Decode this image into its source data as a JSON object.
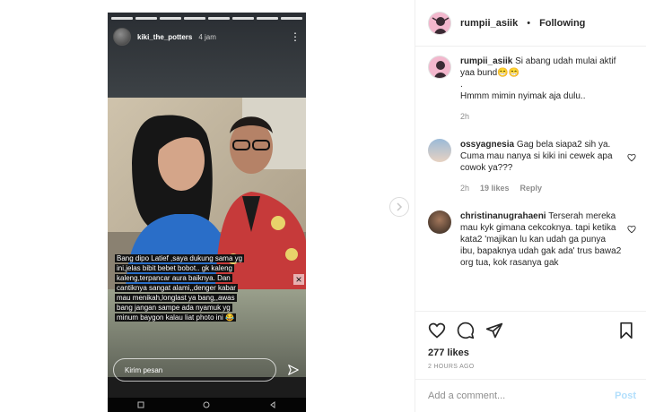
{
  "story": {
    "username": "kiki_the_potters",
    "time": "4 jam",
    "caption": "Bang dipo Latief ,saya dukung sama yg ini,jelas bibit bebet bobot.. gk kaleng kaleng,terpancar aura baiknya. Dan cantiknya sangat alami,,denger kabar mau menikah,longlast ya bang,,awas bang jangan sampe ada nyamuk yg minum baygon kalau liat photo ini 😂",
    "reply_placeholder": "Kirim pesan"
  },
  "post": {
    "author": "rumpii_asiik",
    "follow_label": "Following",
    "likes": "277 likes",
    "time_ago": "2 HOURS AGO",
    "add_comment_placeholder": "Add a comment...",
    "post_label": "Post"
  },
  "comments": [
    {
      "username": "rumpii_asiik",
      "lines": [
        "Si abang udah mulai aktif yaa bund😁😁",
        ".",
        "Hmmm mimin nyimak aja dulu.."
      ],
      "time": "2h",
      "likes": "",
      "reply": ""
    },
    {
      "username": "ossyagnesia",
      "lines": [
        "Gag bela siapa2 sih ya.",
        "Cuma mau nanya si kiki ini cewek apa cowok ya???"
      ],
      "time": "2h",
      "likes": "19 likes",
      "reply": "Reply"
    },
    {
      "username": "christinanugrahaeni",
      "lines": [
        "Terserah mereka mau kyk gimana cekcoknya. tapi ketika kata2 'majikan lu kan udah ga punya ibu, bapaknya udah gak ada' trus bawa2 org tua, kok rasanya gak"
      ],
      "time": "",
      "likes": "",
      "reply": ""
    }
  ],
  "icons": {
    "heart": "heart-icon",
    "comment": "comment-icon",
    "share": "share-icon",
    "save": "bookmark-icon",
    "next": "chevron-right-icon"
  },
  "colors": {
    "post_button": "#b2dffc",
    "muted_text": "#8e8e8e",
    "avatar_pink": "#f3b7cd"
  }
}
